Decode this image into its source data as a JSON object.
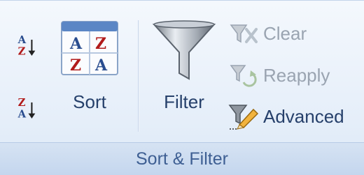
{
  "group": {
    "caption": "Sort & Filter"
  },
  "buttons": {
    "sort": {
      "label": "Sort"
    },
    "filter": {
      "label": "Filter"
    },
    "clear": {
      "label": "Clear",
      "enabled": false,
      "icon": "clear-filter-icon"
    },
    "reapply": {
      "label": "Reapply",
      "enabled": false,
      "icon": "reapply-filter-icon"
    },
    "advanced": {
      "label": "Advanced",
      "enabled": true,
      "icon": "advanced-filter-icon"
    },
    "sort_az": {
      "icon": "sort-a-to-z-icon",
      "glyph_top": "A",
      "glyph_bottom": "Z"
    },
    "sort_za": {
      "icon": "sort-z-to-a-icon",
      "glyph_top": "Z",
      "glyph_bottom": "A"
    }
  },
  "colors": {
    "accent": "#26406b",
    "caption_text": "#3e5f93",
    "letter_blue": "#2a4d8f",
    "letter_red": "#b11a1a"
  }
}
